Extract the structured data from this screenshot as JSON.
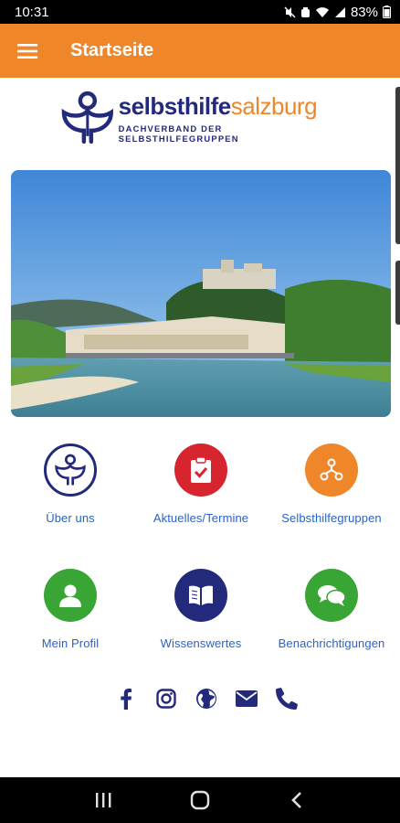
{
  "status_bar": {
    "time": "10:31",
    "battery": "83%"
  },
  "app_bar": {
    "title": "Startseite"
  },
  "logo": {
    "word_primary": "selbsthilfe",
    "word_secondary": "salzburg",
    "subtitle": "DACHVERBAND DER SELBSTHILFEGRUPPEN"
  },
  "tiles": [
    {
      "label": "Über uns",
      "icon": "logo-people-icon",
      "color": "#ffffff"
    },
    {
      "label": "Aktuelles/Termine",
      "icon": "clipboard-check-icon",
      "color": "#d6252f"
    },
    {
      "label": "Selbsthilfegruppen",
      "icon": "network-icon",
      "color": "#f0862a"
    },
    {
      "label": "Mein Profil",
      "icon": "user-icon",
      "color": "#39a535"
    },
    {
      "label": "Wissenswertes",
      "icon": "book-icon",
      "color": "#232a7c"
    },
    {
      "label": "Benachrichtigungen",
      "icon": "chat-icon",
      "color": "#39a535"
    }
  ],
  "social": [
    "facebook-icon",
    "instagram-icon",
    "globe-icon",
    "mail-icon",
    "phone-icon"
  ],
  "colors": {
    "brand_orange": "#f0862a",
    "brand_navy": "#232a7c",
    "label_blue": "#2a63c7"
  }
}
